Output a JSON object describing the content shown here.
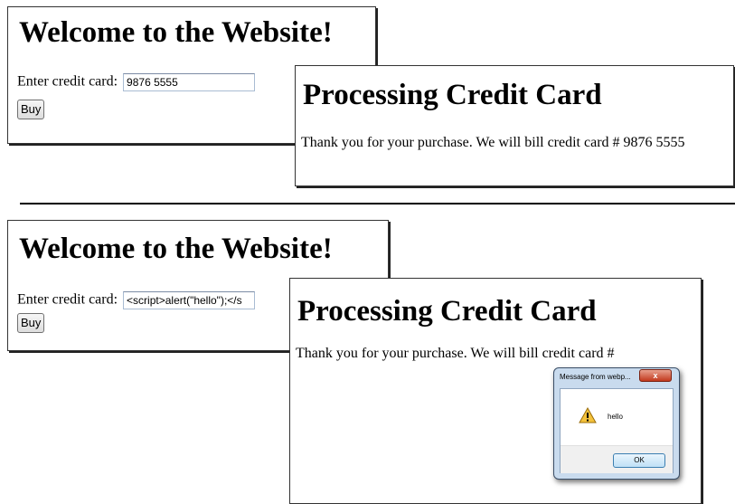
{
  "top": {
    "welcome": {
      "title": "Welcome to the Website!",
      "label": "Enter credit card:",
      "input_value": "9876 5555",
      "buy_label": "Buy"
    },
    "processing": {
      "title": "Processing Credit Card",
      "message": "Thank you for your purchase. We will bill credit card # 9876 5555"
    }
  },
  "bottom": {
    "welcome": {
      "title": "Welcome to the Website!",
      "label": "Enter credit card:",
      "input_value": "<script>alert(\"hello\");</s",
      "buy_label": "Buy"
    },
    "processing": {
      "title": "Processing Credit Card",
      "message": "Thank you for your purchase. We will bill credit card #"
    },
    "dialog": {
      "title": "Message from webp...",
      "close_label": "x",
      "message": "hello",
      "ok_label": "OK",
      "icon": "warning-icon"
    }
  }
}
